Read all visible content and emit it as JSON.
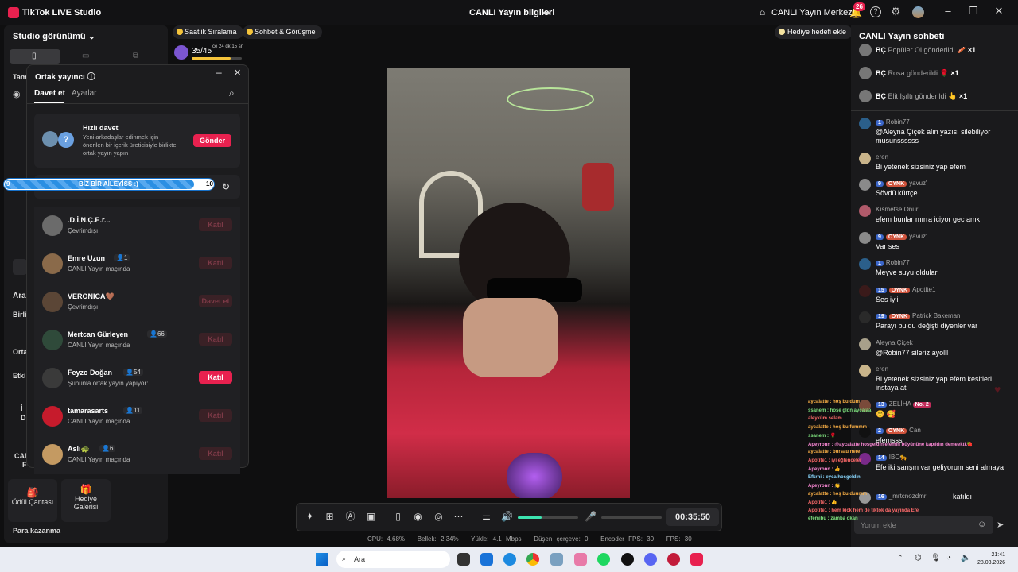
{
  "window": {
    "app_title": "TikTok LIVE Studio",
    "center_title": "CANLI Yayın bilgileri",
    "live_center": "CANLI Yayın Merkezi",
    "notif_count": "26"
  },
  "left": {
    "studio_view": "Studio görünümü",
    "frags": [
      "Tam",
      "Ara",
      "Birli",
      "Orta",
      "Etkil",
      "İ",
      "D",
      "CAN",
      "F"
    ],
    "tiles": [
      {
        "label": "Ödül Çantası"
      },
      {
        "label": "Hediye Galerisi"
      }
    ],
    "earn": "Para kazanma"
  },
  "top_pills": [
    "Saatlik Sıralama",
    "Sohbet & Görüşme"
  ],
  "score": {
    "value": "35/45",
    "time": "ce 24 dk 15 sn"
  },
  "gift_goal": "Hediye hedefi ekle",
  "popup": {
    "title": "Ortak yayıncı",
    "tabs": [
      "Davet et",
      "Ayarlar"
    ],
    "quick": {
      "title": "Hızlı davet",
      "desc": "Yeni arkadaşlar edinmek için önerilen bir içerik üreticisiyle birlikte ortak yayın yapın",
      "button": "Gönder"
    },
    "rows": [
      {
        "name": ".D.İ.N.Ç.E.r...",
        "status": "Çevrimdışı",
        "btn": "Katıl",
        "on": false,
        "color": "#6b6b6b"
      },
      {
        "name": "Emre Uzun",
        "count": "1",
        "status": "CANLI Yayın maçında",
        "btn": "Katıl",
        "on": false,
        "color": "#8a6a4a"
      },
      {
        "name": "VERONICA🤎",
        "status": "Çevrimdışı",
        "btn": "Davet et",
        "on": false,
        "color": "#5b4636"
      },
      {
        "name": "Mertcan Gürleyen",
        "count": "66",
        "status": "CANLI Yayın maçında",
        "btn": "Katıl",
        "on": false,
        "color": "#2f4a3a"
      },
      {
        "name": "Feyzo Doğan",
        "count": "54",
        "status": "Şununla ortak yayın yapıyor:",
        "btn": "Katıl",
        "on": true,
        "color": "#3a3a3a"
      },
      {
        "name": "tamarasarts",
        "count": "11",
        "status": "CANLI Yayın maçında",
        "btn": "Katıl",
        "on": false,
        "color": "#c61b2c"
      },
      {
        "name": "Aslı🐢",
        "count": "6",
        "status": "CANLI Yayın maçında",
        "btn": "Katıl",
        "on": false,
        "color": "#c49a62"
      }
    ]
  },
  "goal_bar": {
    "left": "9",
    "label": "BİZ BİR AİLEYİSS :)",
    "right": "10",
    "progress": 0.9
  },
  "chat": {
    "title": "CANLI Yayın sohbeti",
    "gifts": [
      {
        "user": "BÇ",
        "text": "Popüler Ol gönderildi",
        "count": "×1",
        "icon": "🥓"
      },
      {
        "user": "BÇ",
        "text": "Rosa gönderildi",
        "count": "×1",
        "icon": "🌹"
      },
      {
        "user": "BÇ",
        "text": "Elit Işıltı gönderildi",
        "count": "×1",
        "icon": "👆"
      }
    ],
    "messages": [
      {
        "lv": "1",
        "fan": "",
        "user": "Robin77",
        "text": "@Aleyna Çiçek alın yazısı silebiliyor musunssssss",
        "color": "#2b5f8a"
      },
      {
        "lv": "",
        "fan": "",
        "user": "eren",
        "text": "Bi yetenek sizsiniz yap efem",
        "color": "#c9b48a"
      },
      {
        "lv": "9",
        "fan": "OYNK",
        "user": "yavuz'",
        "text": "Sövdü kürtçe",
        "color": "#8a8a8a"
      },
      {
        "lv": "",
        "fan": "",
        "user": "Kısmetse Onur",
        "text": "efem bunlar mırra iciyor gec amk",
        "color": "#b05a6a"
      },
      {
        "lv": "9",
        "fan": "OYNK",
        "user": "yavuz'",
        "text": "Var ses",
        "color": "#8a8a8a"
      },
      {
        "lv": "1",
        "fan": "",
        "user": "Robin77",
        "text": "Meyve suyu oldular",
        "color": "#2b5f8a"
      },
      {
        "lv": "15",
        "fan": "OYNK",
        "user": "Apotite1",
        "text": "Ses iyii",
        "color": "#3a1a1a"
      },
      {
        "lv": "19",
        "fan": "OYNK",
        "user": "Patrick Bakeman",
        "text": "Parayı buldu değişti diyenler var",
        "color": "#2a2a2a"
      },
      {
        "lv": "",
        "fan": "",
        "user": "Aleyna Çiçek",
        "text": "@Robin77 sileriz ayolll",
        "color": "#a8a08a"
      },
      {
        "lv": "",
        "fan": "",
        "user": "eren",
        "text": "Bi yetenek sizsiniz yap efem kesitleri instaya at",
        "color": "#c9b48a"
      },
      {
        "lv": "13",
        "fan": "",
        "user": "ZELİHA",
        "text": "😊 🥰",
        "color": "#7a4a3a"
      },
      {
        "lv": "2",
        "fan": "OYNK",
        "user": "Can",
        "text": "efemsss",
        "color": "#111"
      },
      {
        "lv": "14",
        "fan": "",
        "user": "İBO🐆",
        "text": "Efe iki sarışın var geliyorum seni almaya",
        "color": "#7a2a8a"
      },
      {
        "lv": "16",
        "fan": "",
        "user": "_mrtcnozdmr",
        "text": "katıldı",
        "color": "#999"
      }
    ],
    "zeliha_badge": "No. 2",
    "comment_placeholder": "Yorum ekle"
  },
  "overlay_chat": [
    "aycalatte : hoş buldum",
    "ssanem : hoşe gldn aycalaa",
    "aleyküm selam",
    "aycalatte : hoş bulfummm",
    "ssanem : 🌹",
    "Apeyronn : @aycalatte hoşgeldin efemin büyününe kapıldın demeektk🍓",
    "aycalatte : bursau nere",
    "Apotite1 : iyi eğlenceler",
    "Apeyronn : 👍",
    "Efkrni : eyca hoşgeldin",
    "Apeyronn : 👏",
    "aycalatte : hoş bulduumm",
    "Apotite1 : 👍",
    "Apotite1 : hem kick hem de tiktok da yayında Efe",
    "efemibu : zamba okan"
  ],
  "controls": {
    "timer": "00:35:50"
  },
  "status": {
    "cpu": "CPU: 4.68%",
    "mem": "Bellek: 2.34%",
    "upload": "Yükle: 4.1 Mbps",
    "drop": "Düşen çerçeve: 0",
    "enc": "Encoder FPS: 30",
    "fps": "FPS: 30"
  },
  "taskbar": {
    "search": "Ara",
    "time": "21:41",
    "date": "28.03.2026"
  }
}
